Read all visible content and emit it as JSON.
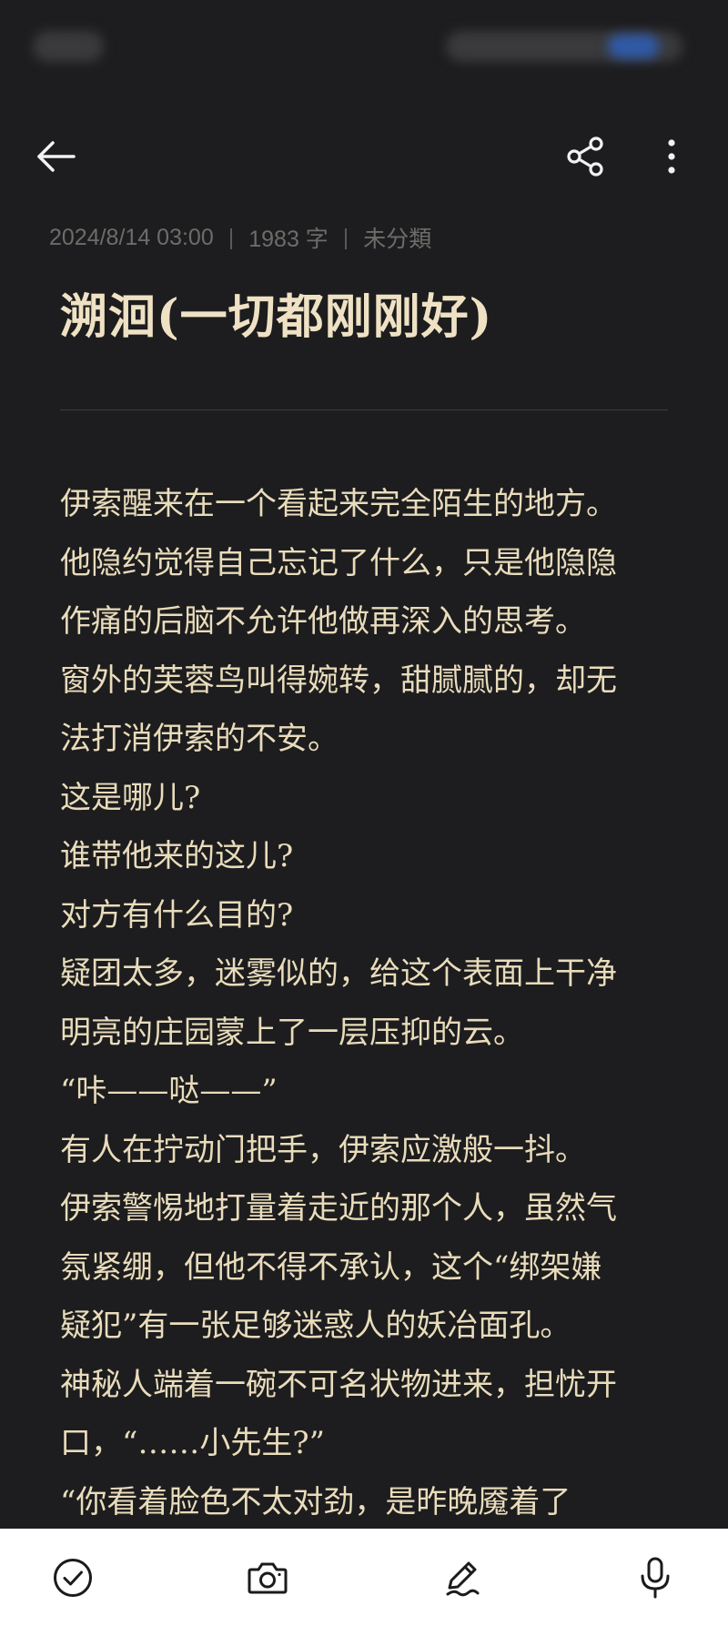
{
  "colors": {
    "background": "#1d1d1f",
    "text": "#e9dcbb",
    "title": "#efe2c4",
    "meta": "#6e6c69",
    "bottom_bar": "#ffffff"
  },
  "toolbar": {
    "back_icon": "arrow-left-icon",
    "share_icon": "share-icon",
    "more_icon": "more-vertical-icon"
  },
  "meta": {
    "datetime": "2024/8/14 03:00",
    "separator": "|",
    "word_count": "1983 字",
    "category": "未分類"
  },
  "note": {
    "title": "溯洄(一切都刚刚好)",
    "lines": [
      "伊索醒来在一个看起来完全陌生的地方。",
      "他隐约觉得自己忘记了什么，只是他隐隐",
      "作痛的后脑不允许他做再深入的思考。",
      "窗外的芙蓉鸟叫得婉转，甜腻腻的，却无",
      "法打消伊索的不安。",
      "这是哪儿?",
      "谁带他来的这儿?",
      "对方有什么目的?",
      "疑团太多，迷雾似的，给这个表面上干净",
      "明亮的庄园蒙上了一层压抑的云。",
      "“咔——哒——”",
      "有人在拧动门把手，伊索应激般一抖。",
      "伊索警惕地打量着走近的那个人，虽然气",
      "氛紧绷，但他不得不承认，这个“绑架嫌",
      "疑犯”有一张足够迷惑人的妖冶面孔。",
      "神秘人端着一碗不可名状物进来，担忧开",
      "口，“……小先生?”",
      "“你看着脸色不太对劲，是昨晚魇着了"
    ]
  },
  "bottom_bar": {
    "check_icon": "check-circle-icon",
    "camera_icon": "camera-icon",
    "pen_icon": "pen-icon",
    "mic_icon": "microphone-icon"
  }
}
